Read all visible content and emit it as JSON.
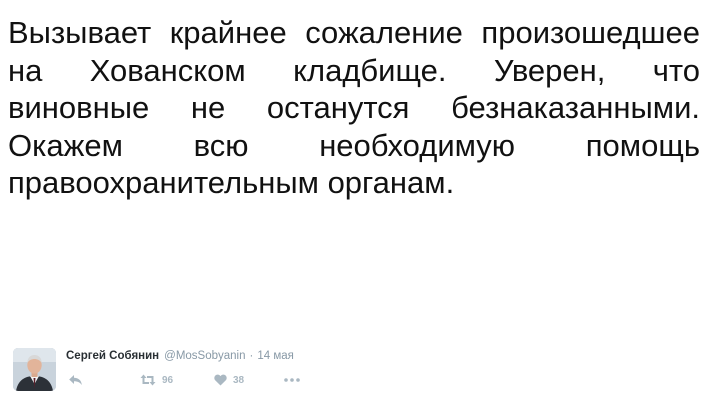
{
  "tweet": {
    "lines": [
      "Вызывает крайнее сожаление произошедшее",
      "на Хованском кладбище. Уверен, что",
      "виновные не останутся безнаказанными.",
      "Окажем всю необходимую помощь",
      "правоохранительным органам."
    ]
  },
  "author": {
    "name": "Сергей Собянин",
    "handle": "@MosSobyanin",
    "separator": "·",
    "date": "14 мая"
  },
  "actions": {
    "reply": {
      "icon": "reply-icon"
    },
    "retweet": {
      "icon": "retweet-icon",
      "count": "96"
    },
    "like": {
      "icon": "heart-icon",
      "count": "38"
    },
    "more": {
      "icon": "more-icon"
    }
  },
  "colors": {
    "text": "#111111",
    "muted": "#8899a6",
    "icon": "#aab8c2"
  }
}
